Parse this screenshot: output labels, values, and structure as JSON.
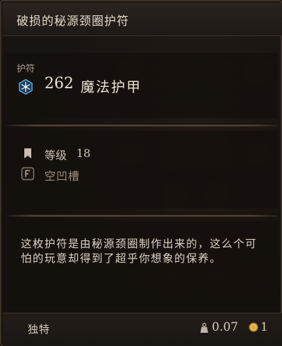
{
  "tooltip": {
    "title": "破损的秘源颈圈护符",
    "category": "护符",
    "armor": {
      "value": "262",
      "label": "魔法护甲",
      "icon": "magic-armor-snowflake-icon"
    },
    "level": {
      "label": "等级",
      "value": "18",
      "icon": "bookmark-icon"
    },
    "slot": {
      "label": "空凹槽",
      "icon": "empty-socket-icon"
    },
    "description": "这枚护符是由秘源颈圈制作出来的，这么个可怕的玩意却得到了超乎你想象的保养。",
    "footer": {
      "rarity": "独特",
      "weight": "0.07",
      "weight_icon": "weight-icon",
      "value": "1",
      "value_icon": "gold-coin-icon"
    },
    "colors": {
      "background": "#15110e",
      "title_bar": "#2a2420",
      "text_primary": "#ece4d6",
      "text_muted": "#9a8e82",
      "armor_icon": "#4aa3e0",
      "coin": "#d9a63a"
    }
  }
}
